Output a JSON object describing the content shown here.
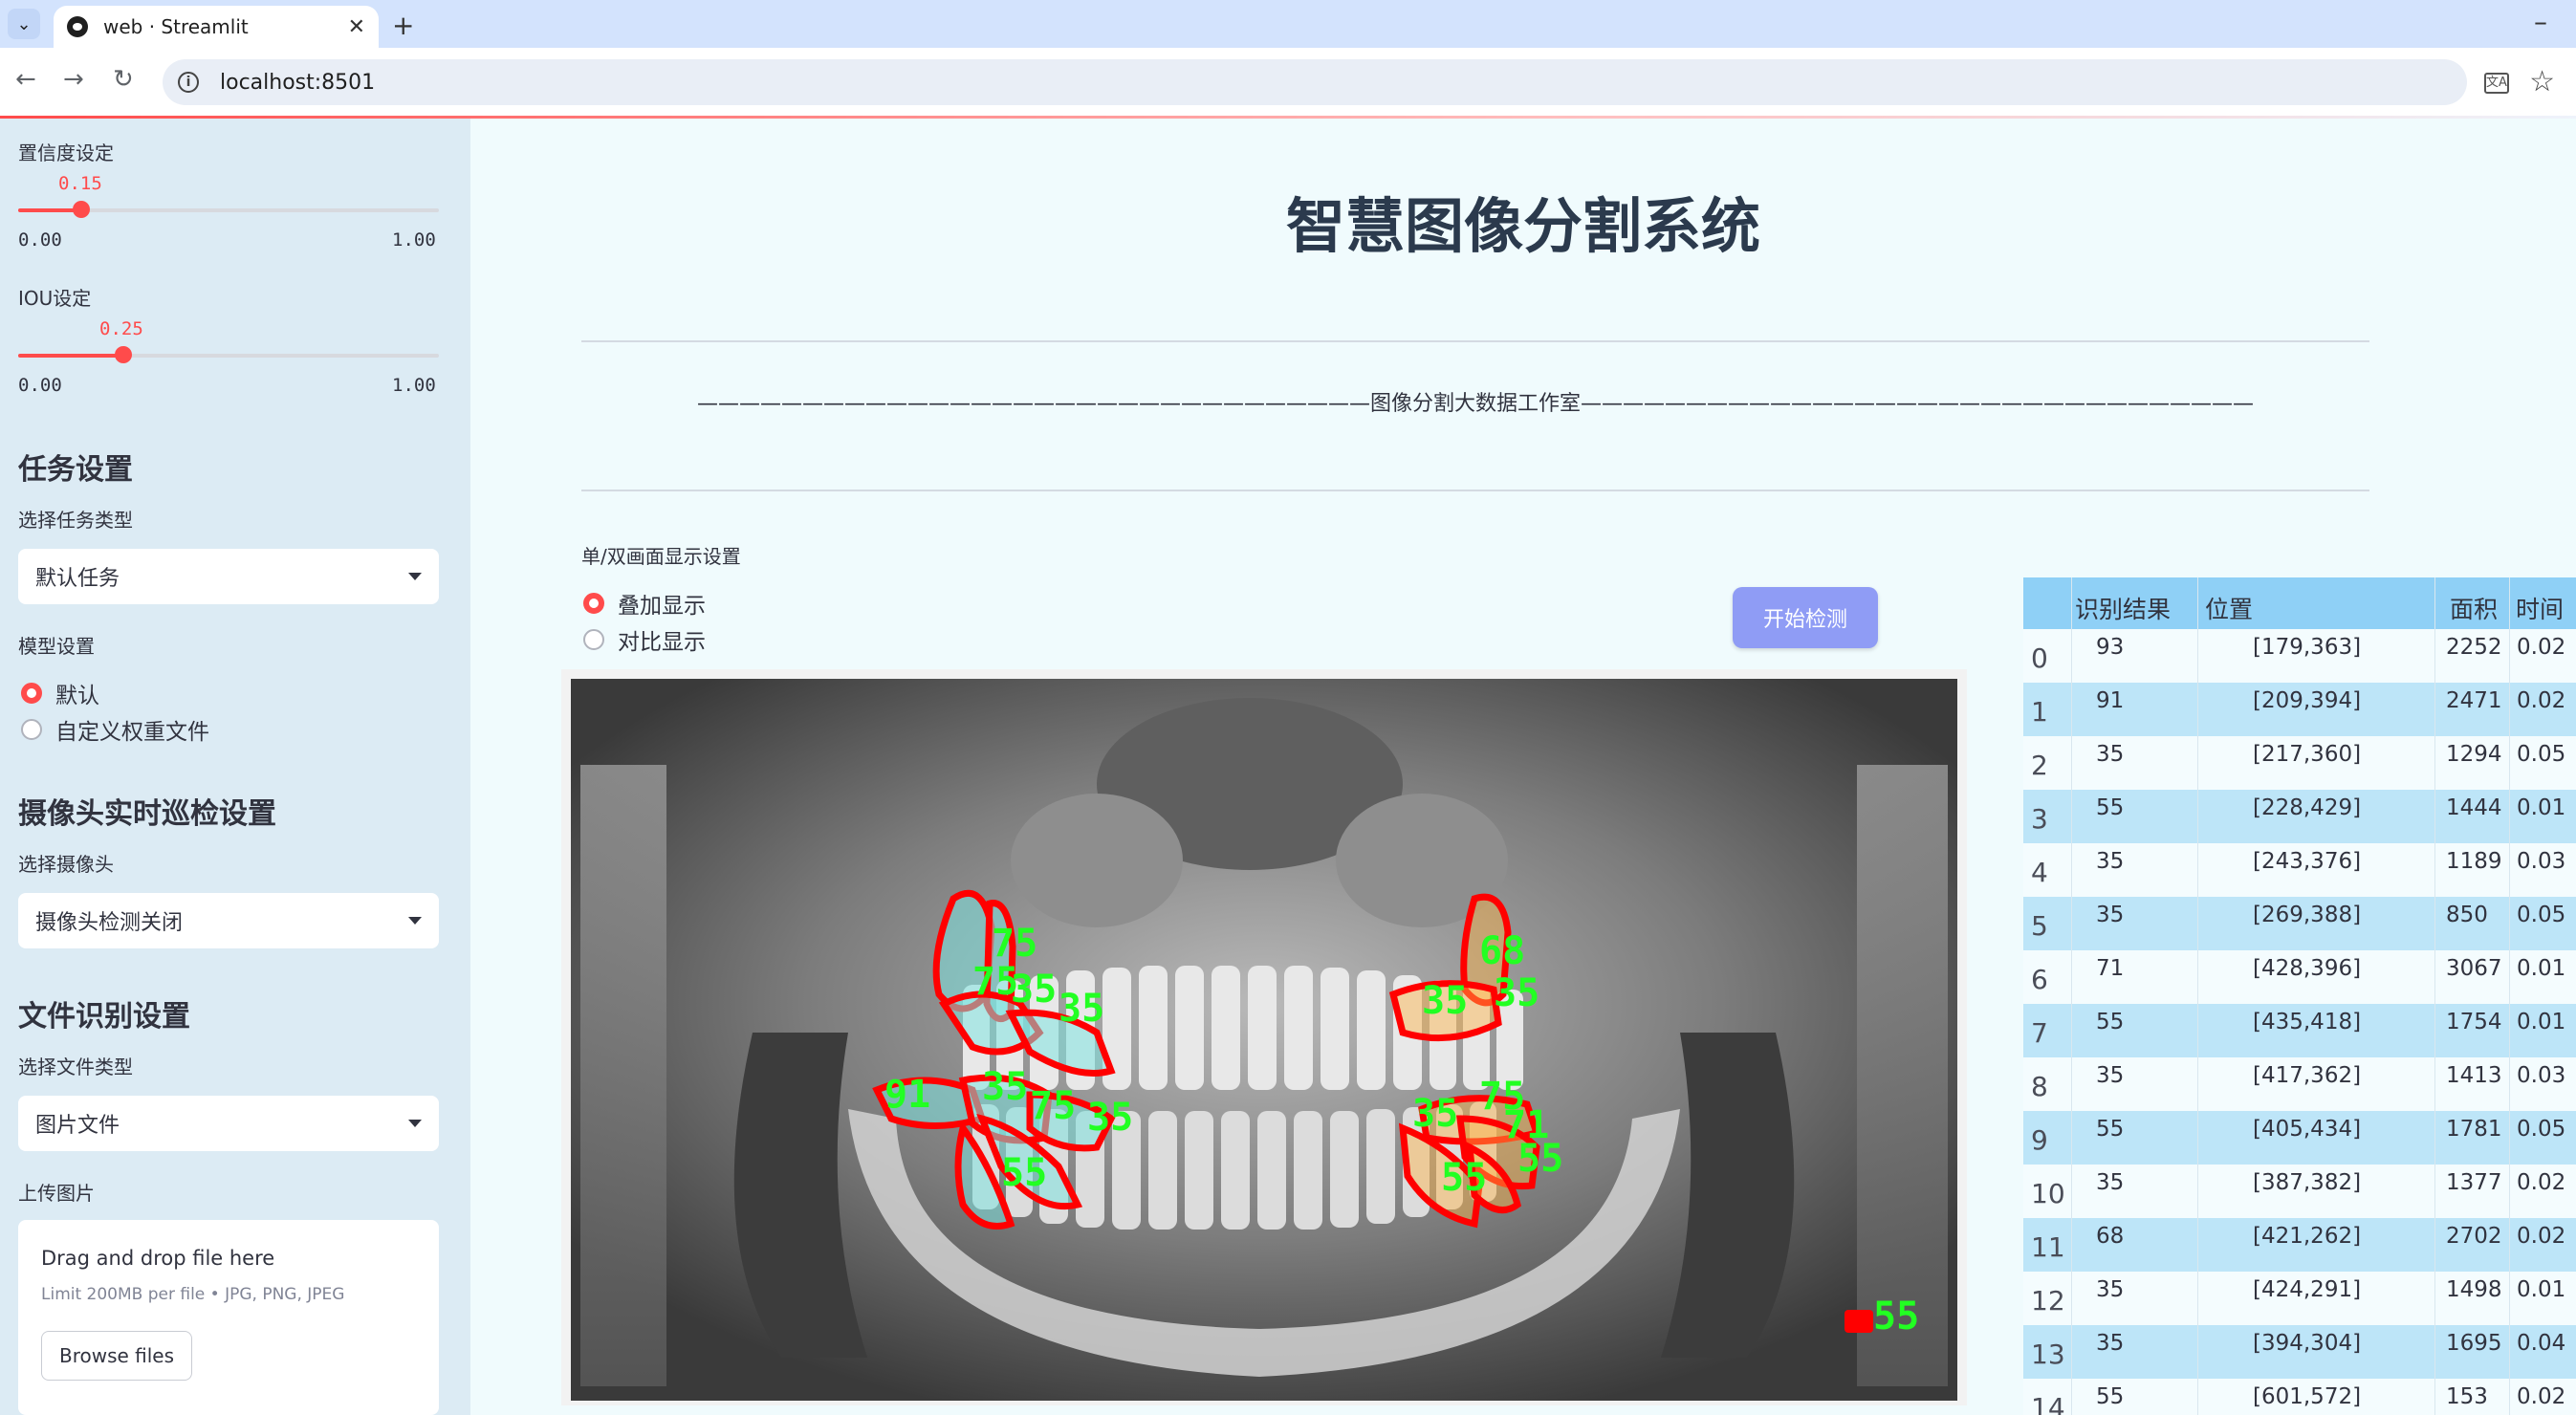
{
  "browser": {
    "tab_title": "web · Streamlit",
    "url": "localhost:8501"
  },
  "sidebar": {
    "confidence": {
      "label": "置信度设定",
      "value": "0.15",
      "value_num": 0.15,
      "min": "0.00",
      "max": "1.00"
    },
    "iou": {
      "label": "IOU设定",
      "value": "0.25",
      "value_num": 0.25,
      "min": "0.00",
      "max": "1.00"
    },
    "task_heading": "任务设置",
    "task_type_label": "选择任务类型",
    "task_type_value": "默认任务",
    "model_label": "模型设置",
    "model_options": [
      "默认",
      "自定义权重文件"
    ],
    "model_selected": "默认",
    "camera_heading": "摄像头实时巡检设置",
    "camera_label": "选择摄像头",
    "camera_value": "摄像头检测关闭",
    "file_heading": "文件识别设置",
    "file_type_label": "选择文件类型",
    "file_type_value": "图片文件",
    "upload_label": "上传图片",
    "uploader": {
      "title": "Drag and drop file here",
      "limit": "Limit 200MB per file • JPG, PNG, JPEG",
      "button": "Browse files"
    }
  },
  "main": {
    "title": "智慧图像分割系统",
    "banner": "————————————————————————————————图像分割大数据工作室————————————————————————————————",
    "display_label": "单/双画面显示设置",
    "display_options": [
      "叠加显示",
      "对比显示"
    ],
    "display_selected": "叠加显示",
    "detect_button": "开始检测",
    "image_labels": [
      "75",
      "75",
      "35",
      "35",
      "91",
      "35",
      "75",
      "35",
      "55",
      "68",
      "35",
      "35",
      "75",
      "35",
      "71",
      "55",
      "55",
      "55"
    ]
  },
  "results_table": {
    "columns": [
      "识别结果",
      "位置",
      "面积",
      "时间"
    ],
    "rows": [
      {
        "idx": "0",
        "result": "93",
        "position": "[179,363]",
        "area": "2252",
        "time": "0.02"
      },
      {
        "idx": "1",
        "result": "91",
        "position": "[209,394]",
        "area": "2471",
        "time": "0.02"
      },
      {
        "idx": "2",
        "result": "35",
        "position": "[217,360]",
        "area": "1294",
        "time": "0.05"
      },
      {
        "idx": "3",
        "result": "55",
        "position": "[228,429]",
        "area": "1444",
        "time": "0.01"
      },
      {
        "idx": "4",
        "result": "35",
        "position": "[243,376]",
        "area": "1189",
        "time": "0.03"
      },
      {
        "idx": "5",
        "result": "35",
        "position": "[269,388]",
        "area": "850",
        "time": "0.05"
      },
      {
        "idx": "6",
        "result": "71",
        "position": "[428,396]",
        "area": "3067",
        "time": "0.01"
      },
      {
        "idx": "7",
        "result": "55",
        "position": "[435,418]",
        "area": "1754",
        "time": "0.01"
      },
      {
        "idx": "8",
        "result": "35",
        "position": "[417,362]",
        "area": "1413",
        "time": "0.03"
      },
      {
        "idx": "9",
        "result": "55",
        "position": "[405,434]",
        "area": "1781",
        "time": "0.05"
      },
      {
        "idx": "10",
        "result": "35",
        "position": "[387,382]",
        "area": "1377",
        "time": "0.02"
      },
      {
        "idx": "11",
        "result": "68",
        "position": "[421,262]",
        "area": "2702",
        "time": "0.02"
      },
      {
        "idx": "12",
        "result": "35",
        "position": "[424,291]",
        "area": "1498",
        "time": "0.01"
      },
      {
        "idx": "13",
        "result": "35",
        "position": "[394,304]",
        "area": "1695",
        "time": "0.04"
      },
      {
        "idx": "14",
        "result": "55",
        "position": "[601,572]",
        "area": "153",
        "time": "0.02"
      }
    ]
  },
  "colors": {
    "accent": "#ff4b4b",
    "sidebar_bg": "#dcebf4",
    "main_bg": "#f0fbfd",
    "table_header": "#8fd0f6",
    "table_alt_row": "#bde5f8",
    "button": "#8f9cf5",
    "segment_outline": "#ff0000",
    "segment_label": "#22ff22"
  }
}
